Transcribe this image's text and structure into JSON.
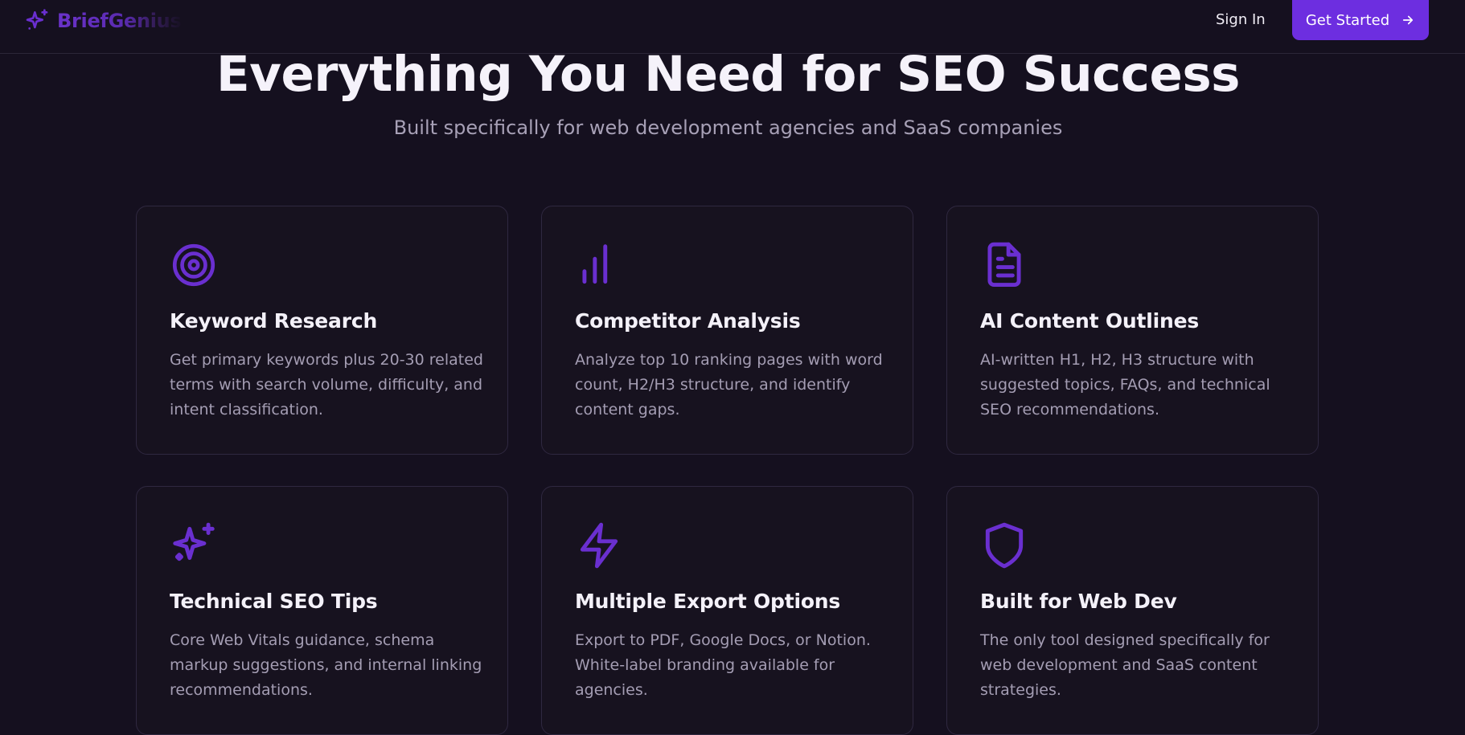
{
  "header": {
    "brand": "BriefGenius",
    "sign_in": "Sign In",
    "cta": "Get Started"
  },
  "hero": {
    "title": "Everything You Need for SEO Success",
    "subtitle": "Built specifically for web development agencies and SaaS companies"
  },
  "features": [
    {
      "icon": "target-icon",
      "title": "Keyword Research",
      "description": "Get primary keywords plus 20-30 related terms with search volume, difficulty, and intent classification."
    },
    {
      "icon": "bar-chart-icon",
      "title": "Competitor Analysis",
      "description": "Analyze top 10 ranking pages with word count, H2/H3 structure, and identify content gaps."
    },
    {
      "icon": "document-icon",
      "title": "AI Content Outlines",
      "description": "AI-written H1, H2, H3 structure with suggested topics, FAQs, and technical SEO recommendations."
    },
    {
      "icon": "sparkles-icon",
      "title": "Technical SEO Tips",
      "description": "Core Web Vitals guidance, schema markup suggestions, and internal linking recommendations."
    },
    {
      "icon": "lightning-icon",
      "title": "Multiple Export Options",
      "description": "Export to PDF, Google Docs, or Notion. White-label branding available for agencies."
    },
    {
      "icon": "shield-icon",
      "title": "Built for Web Dev",
      "description": "The only tool designed specifically for web development and SaaS content strategies."
    }
  ],
  "colors": {
    "background": "#15101f",
    "accent": "#6d2ee0",
    "icon": "#6a2fd0",
    "card_border": "#2f2840"
  }
}
